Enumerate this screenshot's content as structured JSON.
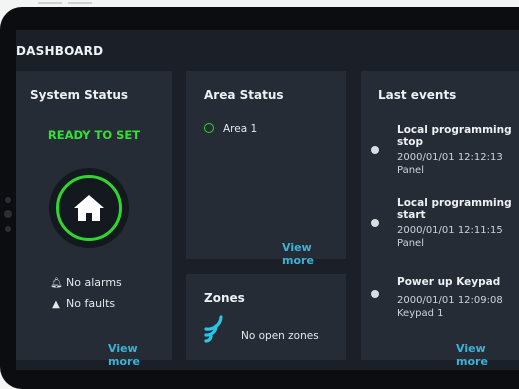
{
  "header": {
    "title": "DASHBOARD"
  },
  "system_status": {
    "title": "System Status",
    "state": "READY TO SET",
    "alarms": "No alarms",
    "faults": "No faults",
    "view_more": "View more"
  },
  "area_status": {
    "title": "Area Status",
    "areas": [
      {
        "label": "Area 1"
      }
    ],
    "view_more": "View more"
  },
  "zones": {
    "title": "Zones",
    "text": "No open zones"
  },
  "last_events": {
    "title": "Last events",
    "events": [
      {
        "title": "Local programming stop",
        "date": "2000/01/01 12:12:13",
        "source": "Panel"
      },
      {
        "title": "Local programming start",
        "date": "2000/01/01 12:11:15",
        "source": "Panel"
      },
      {
        "title": "Power up Keypad",
        "date": "2000/01/01 12:09:08",
        "source": "Keypad 1"
      }
    ],
    "view_more": "View more"
  },
  "colors": {
    "ready_green": "#35e035",
    "link_blue": "#3bb3d6",
    "panel_bg": "#252c36",
    "screen_bg": "#1b2028"
  },
  "icons": {
    "home": "home-icon",
    "bell": "bell-icon",
    "warning": "warning-icon",
    "zones": "wireless-zones-icon"
  }
}
